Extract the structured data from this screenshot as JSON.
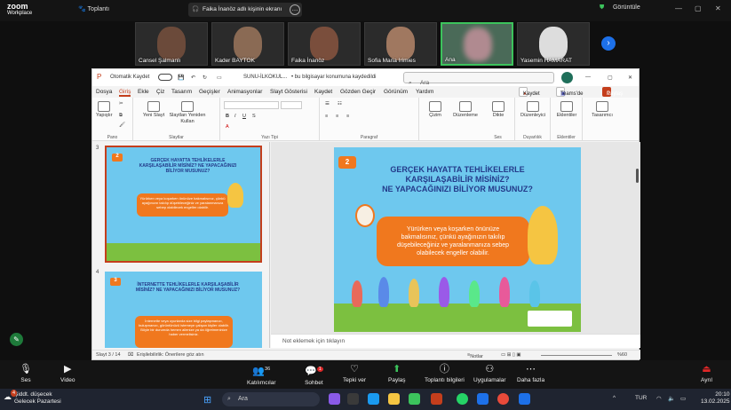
{
  "zoom": {
    "brand_top": "zoom",
    "brand_bottom": "Workplace",
    "meeting_label": "Toplantı",
    "share_banner": "Faika İnanöz adlı kişinin ekranı",
    "view_label": "Görüntüle",
    "participants": [
      "Cansel Şalmanlı",
      "Kader BAYTOK",
      "Faika İnanöz",
      "Sofia Maria Irimies",
      "Ana",
      "Yasemin HAMARAT"
    ],
    "controls": {
      "audio": "Ses",
      "video": "Video",
      "participants": "Katılımcılar",
      "participants_count": "36",
      "chat": "Sohbet",
      "chat_badge": "1",
      "react": "Tepki ver",
      "share": "Paylaş",
      "info": "Toplantı bilgileri",
      "apps": "Uygulamalar",
      "more": "Daha fazla",
      "leave": "Ayrıl"
    }
  },
  "powerpoint": {
    "autosave": "Otomatik Kaydet",
    "filename": "SUNU-İLKOKUL...",
    "save_status": "• bu bilgisayar konumuna kaydedildi",
    "search_placeholder": "Ara",
    "menus": [
      "Dosya",
      "Giriş",
      "Ekle",
      "Çiz",
      "Tasarım",
      "Geçişler",
      "Animasyonlar",
      "Slayt Gösterisi",
      "Kaydet",
      "Gözden Geçir",
      "Görünüm",
      "Yardım"
    ],
    "active_menu": "Giriş",
    "record_btn": "Kaydet",
    "teams_btn": "Teams'de Sun",
    "share_btn": "Paylaş",
    "ribbon": {
      "paste": "Yapıştır",
      "new_slide": "Yeni Slayt",
      "reuse": "Slaytları Yeniden Kullan",
      "drawing": "Çizim",
      "arrange": "Düzenleme",
      "dictate": "Dikte",
      "editor": "Düzenleyici",
      "addins": "Eklentiler",
      "designer": "Tasarımcı",
      "groups": [
        "Pano",
        "Slaytlar",
        "Yazı Tipi",
        "Paragraf",
        "Ses",
        "Duyarlılık",
        "Eklentiler"
      ]
    },
    "notes_placeholder": "Not eklemek için tıklayın",
    "status": {
      "slide": "Slayt 3 / 14",
      "accessibility": "Erişilebilirlik: Önerilere göz atın",
      "notes": "Notlar",
      "zoom": "%60"
    },
    "thumbs": [
      {
        "num": "3",
        "badge": "2",
        "title": "GERÇEK HAYATTA TEHLİKELERLE KARŞILAŞABİLİR MİSİNİZ? NE YAPACAĞINIZI BİLİYOR MUSUNUZ?",
        "body": "Yürürken veya koşarken önünüze bakmalısınız, çünkü ayağınızın takılıp düşebileceğiniz ve yaralanmanıza sebep olabilecek engeller olabilir."
      },
      {
        "num": "4",
        "badge": "3",
        "title": "İNTERNETTE TEHLİKELERLE KARŞILAŞABİLİR MİSİNİZ? NE YAPACAĞINIZI BİLİYOR MUSUNUZ?",
        "body": "İnternette veya oyunlarda size bilgi paylaşmanızı, buluşmanızı, görüntünüzü istemeye çalışan kişiler olabilir. Böyle bir durumda hemen ailenize ya da öğretmeninize haber vermelisiniz."
      }
    ],
    "main_slide": {
      "badge": "2",
      "title_l1": "GERÇEK HAYATTA TEHLİKELERLE",
      "title_l2": "KARŞILAŞABİLİR MİSİNİZ?",
      "title_l3": "NE YAPACAĞINIZI BİLİYOR MUSUNUZ?",
      "body": "Yürürken veya koşarken önünüze bakmalısınız, çünkü ayağınızın takılıp düşebileceğiniz ve yaralanmanıza sebep olabilecek engeller olabilir."
    }
  },
  "taskbar": {
    "weather_temp": "4",
    "weather_title": "Şiddt. düşecek",
    "weather_sub": "Gelecek Pazartesi",
    "search": "Ara",
    "lang": "TUR",
    "time": "20:10",
    "date": "13.02.2025"
  }
}
